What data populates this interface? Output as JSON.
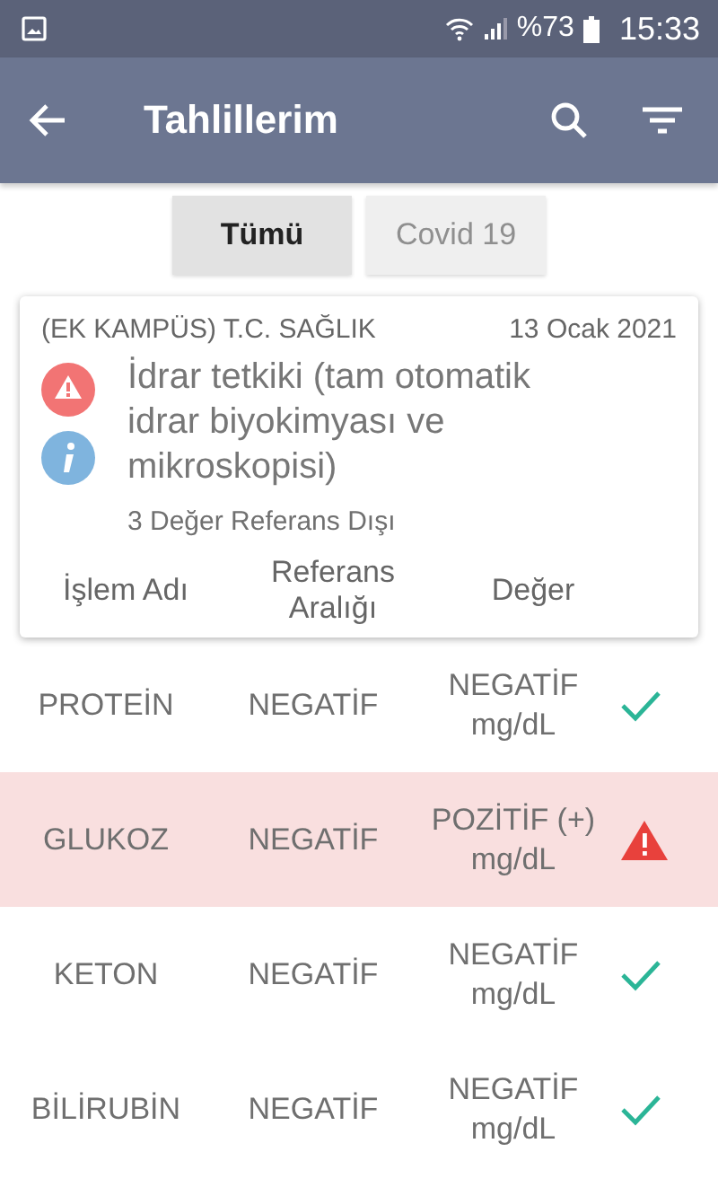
{
  "status_bar": {
    "battery": "%73",
    "time": "15:33"
  },
  "app_bar": {
    "title": "Tahlillerim"
  },
  "tabs": [
    {
      "label": "Tümü",
      "selected": true
    },
    {
      "label": "Covid 19",
      "selected": false
    }
  ],
  "card": {
    "institution": "(EK KAMPÜS) T.C. SAĞLIK",
    "date": "13 Ocak 2021",
    "title": "İdrar tetkiki (tam otomatik idrar biyokimyası ve mikroskopisi)",
    "summary": "3 Değer Referans Dışı",
    "columns": [
      "İşlem Adı",
      "Referans Aralığı",
      "Değer"
    ]
  },
  "rows": [
    {
      "name": "PROTEİN",
      "reference": "NEGATİF",
      "value": "NEGATİF mg/dL",
      "flagged": false
    },
    {
      "name": "GLUKOZ",
      "reference": "NEGATİF",
      "value": "POZİTİF (+) mg/dL",
      "flagged": true
    },
    {
      "name": "KETON",
      "reference": "NEGATİF",
      "value": "NEGATİF mg/dL",
      "flagged": false
    },
    {
      "name": "BİLİRUBİN",
      "reference": "NEGATİF",
      "value": "NEGATİF mg/dL",
      "flagged": false
    }
  ]
}
